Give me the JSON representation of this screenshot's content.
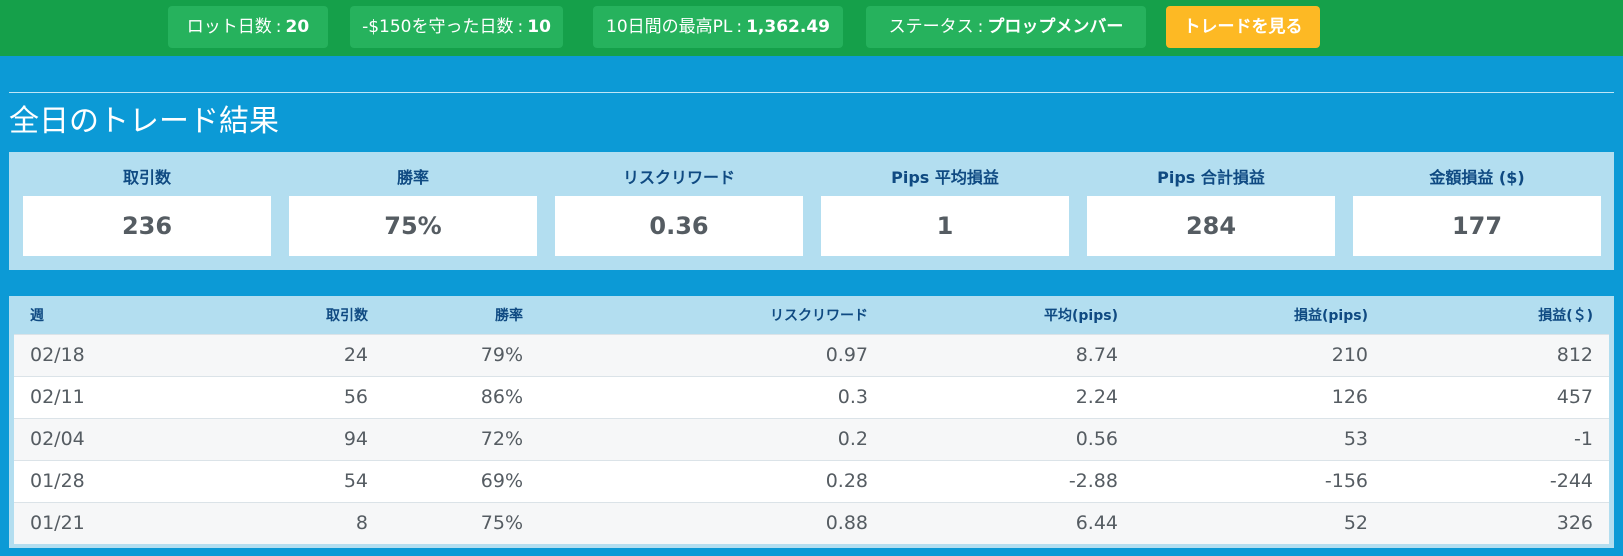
{
  "topbar": {
    "lot_days_label": "ロット日数",
    "lot_days_value": "20",
    "kept_days_label": "-$150を守った日数",
    "kept_days_value": "10",
    "best_pl_label": "10日間の最高PL",
    "best_pl_value": "1,362.49",
    "status_label": "ステータス",
    "status_value": "プロップメンバー",
    "colon": ":",
    "view_trades_button": "トレードを見る",
    "colors": {
      "bar": "#15a04a",
      "pill": "#26b25d",
      "button": "#fdb924"
    }
  },
  "section_title": "全日のトレード結果",
  "summary": [
    {
      "label": "取引数",
      "value": "236"
    },
    {
      "label": "勝率",
      "value": "75%"
    },
    {
      "label": "リスクリワード",
      "value": "0.36"
    },
    {
      "label": "Pips 平均損益",
      "value": "1"
    },
    {
      "label": "Pips 合計損益",
      "value": "284"
    },
    {
      "label": "金額損益 ($)",
      "value": "177"
    }
  ],
  "weekly_table": {
    "headers": [
      "週",
      "取引数",
      "勝率",
      "リスクリワード",
      "平均(pips)",
      "損益(pips)",
      "損益(＄)"
    ],
    "rows": [
      [
        "02/18",
        "24",
        "79%",
        "0.97",
        "8.74",
        "210",
        "812"
      ],
      [
        "02/11",
        "56",
        "86%",
        "0.3",
        "2.24",
        "126",
        "457"
      ],
      [
        "02/04",
        "94",
        "72%",
        "0.2",
        "0.56",
        "53",
        "-1"
      ],
      [
        "01/28",
        "54",
        "69%",
        "0.28",
        "-2.88",
        "-156",
        "-244"
      ],
      [
        "01/21",
        "8",
        "75%",
        "0.88",
        "6.44",
        "52",
        "326"
      ]
    ]
  },
  "colors": {
    "page_background": "#0c9ad6",
    "panel_background": "#b3def0",
    "heading_text": "#0f4a82",
    "value_text": "#555c62"
  }
}
